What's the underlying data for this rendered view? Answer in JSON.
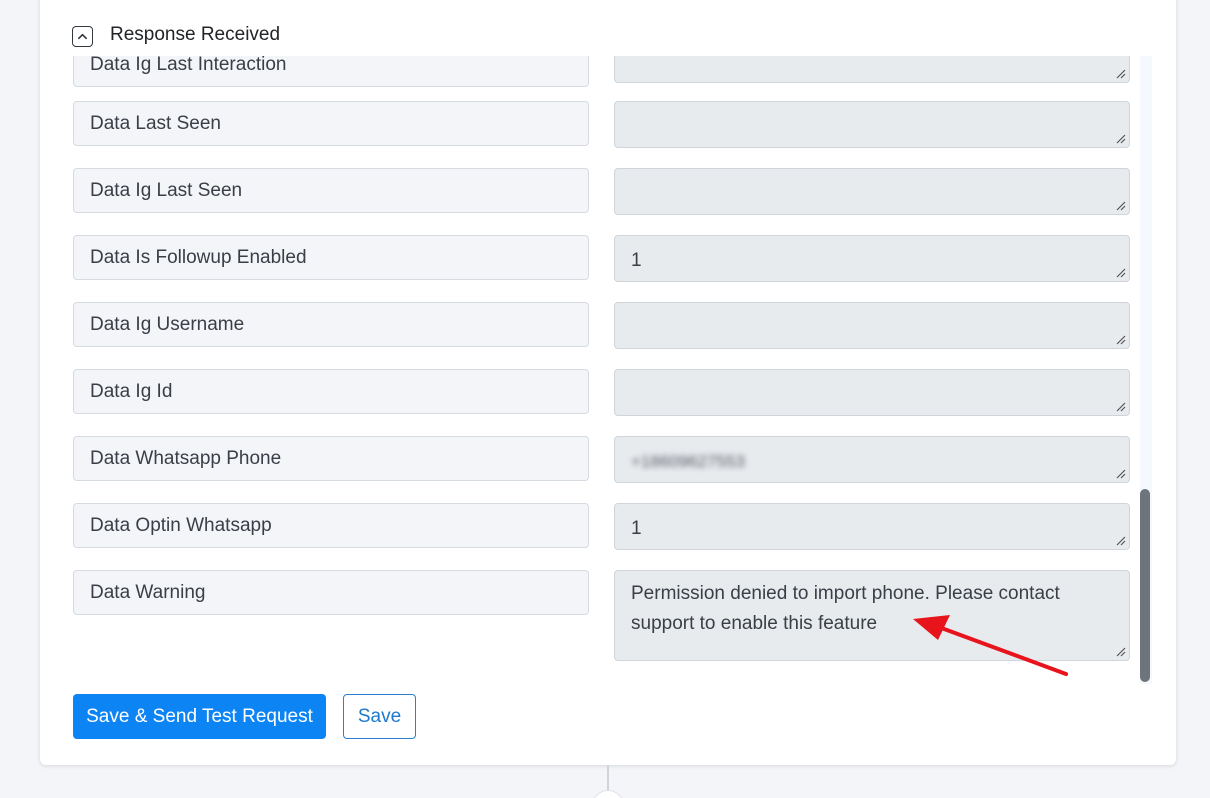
{
  "section": {
    "title": "Response Received",
    "toggle_icon": "chevron-up-icon"
  },
  "rows": [
    {
      "label": "Data Ig Last Interaction",
      "value": ""
    },
    {
      "label": "Data Last Seen",
      "value": ""
    },
    {
      "label": "Data Ig Last Seen",
      "value": ""
    },
    {
      "label": "Data Is Followup Enabled",
      "value": "1"
    },
    {
      "label": "Data Ig Username",
      "value": ""
    },
    {
      "label": "Data Ig Id",
      "value": ""
    },
    {
      "label": "Data Whatsapp Phone",
      "value": "+18609627553"
    },
    {
      "label": "Data Optin Whatsapp",
      "value": "1"
    },
    {
      "label": "Data Warning",
      "value": "Permission denied to import phone. Please contact support to enable this feature"
    }
  ],
  "buttons": {
    "save_send": "Save & Send Test Request",
    "save": "Save"
  },
  "colors": {
    "primary": "#0d84f4",
    "annotation_arrow": "#e8141c",
    "value_bg": "#e8ebee",
    "label_bg": "#f3f5f8"
  }
}
